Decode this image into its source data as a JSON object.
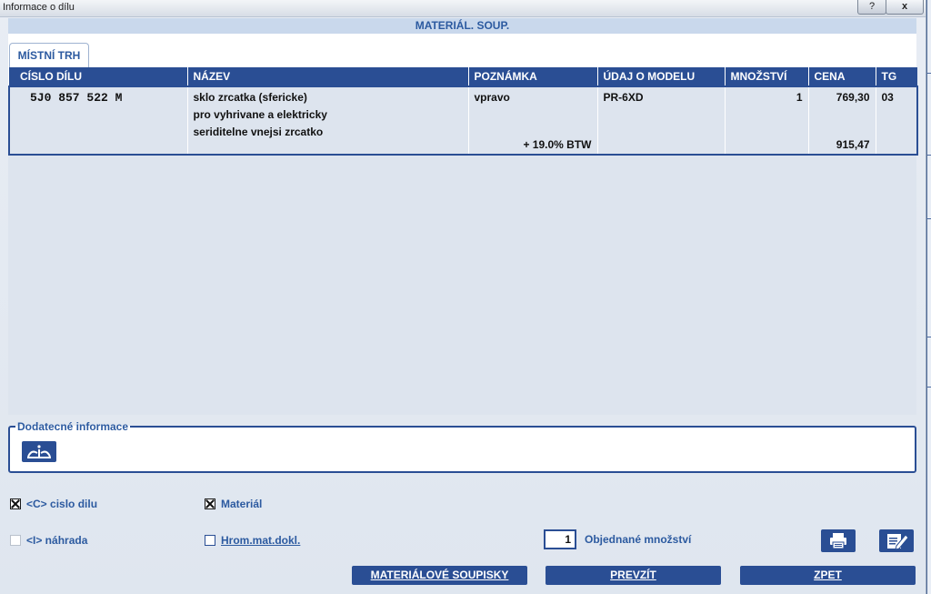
{
  "window": {
    "title": "Informace o dílu",
    "help_glyph": "?",
    "close_glyph": "x"
  },
  "header": {
    "title": "MATERIÁL. SOUP."
  },
  "tabs": [
    {
      "label": "MÍSTNÍ TRH"
    }
  ],
  "table": {
    "columns": [
      "CÍSLO DÍLU",
      "NÁZEV",
      "POZNÁMKA",
      "ÚDAJ O MODELU",
      "MNOŽSTVÍ",
      "CENA",
      "TG"
    ],
    "rows": [
      {
        "part_number": "5J0 857 522 M",
        "name_lines": [
          "sklo zrcatka (sfericke)",
          "pro vyhrivane a elektricky",
          "seriditelne vnejsi zrcatko"
        ],
        "note": "vpravo",
        "note_bottom": "+ 19.0% BTW",
        "model": "PR-6XD",
        "quantity": "1",
        "price": "769,30",
        "price_bottom": "915,47",
        "tg": "03"
      }
    ]
  },
  "additional_info": {
    "legend": "Dodatecné informace",
    "icon": "info-hand-icon"
  },
  "options": {
    "part_number_check": {
      "label": "<C> cislo dilu",
      "checked": true
    },
    "material_check": {
      "label": "Materiál",
      "checked": true
    },
    "replacement_check": {
      "label": "<I> náhrada",
      "checked": false,
      "disabled": true
    },
    "collective_check": {
      "label": "Hrom.mat.dokl.",
      "checked": false
    }
  },
  "order": {
    "quantity": "1",
    "label": "Objednané množství"
  },
  "icons": {
    "print": "printer-icon",
    "edit": "edit-note-icon"
  },
  "buttons": {
    "material_lists": "MATERIÁLOVÉ SOUPISKY",
    "take_over": "PREVZÍT",
    "back": "ZPET"
  },
  "colors": {
    "accent": "#2a4e94",
    "label_blue": "#2c5aa0",
    "row_bg": "#dde4ee",
    "header_band": "#c9d8ec"
  }
}
